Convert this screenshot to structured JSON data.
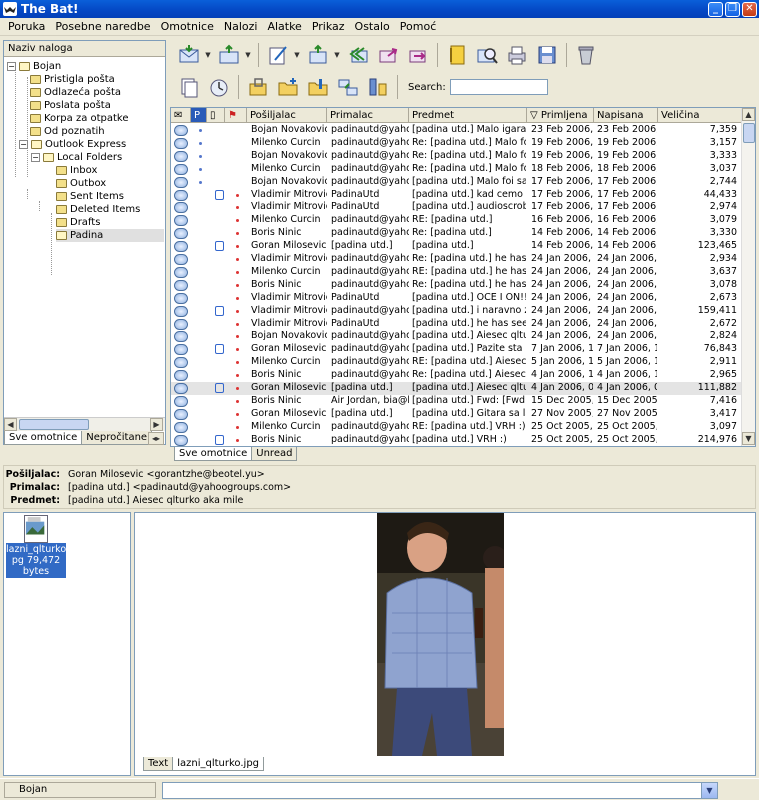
{
  "window": {
    "title": "The Bat!"
  },
  "menu": [
    "Poruka",
    "Posebne naredbe",
    "Omotnice",
    "Nalozi",
    "Alatke",
    "Prikaz",
    "Ostalo",
    "Pomoć"
  ],
  "folders": {
    "header": "Naziv naloga",
    "account": "Bojan",
    "items": [
      "Pristigla pošta",
      "Odlazeća pošta",
      "Poslata pošta",
      "Korpa za otpatke",
      "Od poznatih"
    ],
    "outlook": "Outlook Express",
    "local": "Local Folders",
    "local_items": [
      "Inbox",
      "Outbox",
      "Sent Items",
      "Deleted Items",
      "Drafts",
      "Padina"
    ],
    "tabs": [
      "Sve omotnice",
      "Nepročitane"
    ]
  },
  "toolbar": {
    "search_label": "Search:",
    "search_value": "",
    "icons_row1": [
      "get-mail-icon",
      "send-mail-icon",
      "new-message-icon",
      "reply-icon",
      "reply-all-icon",
      "forward-icon",
      "redirect-icon",
      "address-book-icon",
      "find-icon",
      "print-icon",
      "save-icon",
      "delete-icon"
    ],
    "icons_row2": [
      "copy-message-icon",
      "move-message-icon",
      "new-folder-icon",
      "folder-lock-icon",
      "folder-properties-icon",
      "filter-icon",
      "sort-icon"
    ]
  },
  "columns": [
    "Pošiljalac",
    "Primalac",
    "Predmet",
    "Primljena",
    "Napisana",
    "Veličina"
  ],
  "messages": [
    {
      "from": "Bojan Novakovic",
      "to": "padinautd@yahoo....",
      "subject": "[padina utd.] Malo igara sa [...",
      "received": "23 Feb 2006, ...",
      "written": "23 Feb 2006, ...",
      "size": "7,359",
      "dot": "#5577cc",
      "clip": false
    },
    {
      "from": "Milenko Curcin",
      "to": "padinautd@yahoo....",
      "subject": "Re: [padina utd.] Malo foi sa...",
      "received": "19 Feb 2006, ...",
      "written": "19 Feb 2006, ...",
      "size": "3,157",
      "dot": "#5577cc",
      "clip": false
    },
    {
      "from": "Bojan Novakovic",
      "to": "padinautd@yahoo....",
      "subject": "Re: [padina utd.] Malo foi sa...",
      "received": "19 Feb 2006, ...",
      "written": "19 Feb 2006, ...",
      "size": "3,333",
      "dot": "#5577cc",
      "clip": false
    },
    {
      "from": "Milenko Curcin",
      "to": "padinautd@yahoo....",
      "subject": "Re: [padina utd.] Malo foi sa...",
      "received": "18 Feb 2006, ...",
      "written": "18 Feb 2006, ...",
      "size": "3,037",
      "dot": "#5577cc",
      "clip": false
    },
    {
      "from": "Bojan Novakovic",
      "to": "padinautd@yahoo....",
      "subject": "[padina utd.] Malo foi sa ben...",
      "received": "17 Feb 2006, ...",
      "written": "17 Feb 2006, ...",
      "size": "2,744",
      "dot": "#5577cc",
      "clip": false
    },
    {
      "from": "Vladimir Mitrovic",
      "to": "PadinaUtd",
      "subject": "[padina utd.] kad cemo na tir...",
      "received": "17 Feb 2006, ...",
      "written": "17 Feb 2006, ...",
      "size": "44,433",
      "dot": "#dd3333",
      "clip": true
    },
    {
      "from": "Vladimir Mitrovic",
      "to": "PadinaUtd",
      "subject": "[padina utd.] audioscrobbler",
      "received": "17 Feb 2006, ...",
      "written": "17 Feb 2006, ...",
      "size": "2,974",
      "dot": "#dd3333",
      "clip": false
    },
    {
      "from": "Milenko Curcin",
      "to": "padinautd@yahoo....",
      "subject": "RE: [padina utd.]",
      "received": "16 Feb 2006, ...",
      "written": "16 Feb 2006, ...",
      "size": "3,079",
      "dot": "#dd3333",
      "clip": false
    },
    {
      "from": "Boris Ninic",
      "to": "padinautd@yahoo....",
      "subject": "Re: [padina utd.]",
      "received": "14 Feb 2006, ...",
      "written": "14 Feb 2006, ...",
      "size": "3,330",
      "dot": "#dd3333",
      "clip": false
    },
    {
      "from": "Goran Milosevic",
      "to": "[padina utd.]",
      "subject": "[padina utd.]",
      "received": "14 Feb 2006, ...",
      "written": "14 Feb 2006, ...",
      "size": "123,465",
      "dot": "#dd3333",
      "clip": true
    },
    {
      "from": "Vladimir Mitrovic",
      "to": "padinautd@yahoo....",
      "subject": "Re: [padina utd.] he has see...",
      "received": "24 Jan 2006, ...",
      "written": "24 Jan 2006, ...",
      "size": "2,934",
      "dot": "#dd3333",
      "clip": false
    },
    {
      "from": "Milenko Curcin",
      "to": "padinautd@yahoo....",
      "subject": "RE: [padina utd.] he has see...",
      "received": "24 Jan 2006, ...",
      "written": "24 Jan 2006, ...",
      "size": "3,637",
      "dot": "#dd3333",
      "clip": false
    },
    {
      "from": "Boris Ninic",
      "to": "padinautd@yahoo....",
      "subject": "Re: [padina utd.] he has see...",
      "received": "24 Jan 2006, ...",
      "written": "24 Jan 2006, ...",
      "size": "3,078",
      "dot": "#dd3333",
      "clip": false
    },
    {
      "from": "Vladimir Mitrovic",
      "to": "PadinaUtd",
      "subject": "[padina utd.] OCE I ON!!!! O...",
      "received": "24 Jan 2006, ...",
      "written": "24 Jan 2006, ...",
      "size": "2,673",
      "dot": "#dd3333",
      "clip": false
    },
    {
      "from": "Vladimir Mitrovic",
      "to": "padinautd@yahoo....",
      "subject": "[padina utd.] i naravno zabor...",
      "received": "24 Jan 2006, ...",
      "written": "24 Jan 2006, ...",
      "size": "159,411",
      "dot": "#dd3333",
      "clip": true
    },
    {
      "from": "Vladimir Mitrovic",
      "to": "PadinaUtd",
      "subject": "[padina utd.] he has seen th...",
      "received": "24 Jan 2006, ...",
      "written": "24 Jan 2006, ...",
      "size": "2,672",
      "dot": "#dd3333",
      "clip": false
    },
    {
      "from": "Bojan Novakovic",
      "to": "padinautd@yahoo....",
      "subject": "[padina utd.] Aiesec qlturko...",
      "received": "24 Jan 2006, ...",
      "written": "24 Jan 2006, ...",
      "size": "2,824",
      "dot": "#dd3333",
      "clip": false
    },
    {
      "from": "Goran Milosevic",
      "to": "padinautd@yahoo....",
      "subject": "[padina utd.] Pazite sta sami i...",
      "received": "7 Jan 2006, 1...",
      "written": "7 Jan 2006, 1...",
      "size": "76,843",
      "dot": "#dd3333",
      "clip": true
    },
    {
      "from": "Milenko Curcin",
      "to": "padinautd@yahoo....",
      "subject": "RE: [padina utd.] Aiesec qltur...",
      "received": "5 Jan 2006, 1...",
      "written": "5 Jan 2006, 1...",
      "size": "2,911",
      "dot": "#dd3333",
      "clip": false
    },
    {
      "from": "Boris Ninic",
      "to": "padinautd@yahoo....",
      "subject": "Re: [padina utd.] Aiesec qltur...",
      "received": "4 Jan 2006, 1...",
      "written": "4 Jan 2006, 1...",
      "size": "2,965",
      "dot": "#dd3333",
      "clip": false
    },
    {
      "from": "Goran Milosevic",
      "to": "[padina utd.]",
      "subject": "[padina utd.] Aiesec qlturko ...",
      "received": "4 Jan 2006, 0...",
      "written": "4 Jan 2006, 0...",
      "size": "111,882",
      "dot": "#dd3333",
      "clip": true
    },
    {
      "from": "Boris Ninic",
      "to": "Air Jordan, bia@bi...",
      "subject": "[padina utd.] Fwd: [Fwd: Fw:...",
      "received": "15 Dec 2005, ...",
      "written": "15 Dec 2005, ...",
      "size": "7,416",
      "dot": "#dd3333",
      "clip": false
    },
    {
      "from": "Goran Milosevic",
      "to": "[padina utd.]",
      "subject": "[padina utd.] Gitara sa laseri...",
      "received": "27 Nov 2005, ...",
      "written": "27 Nov 2005, ...",
      "size": "3,417",
      "dot": "#dd3333",
      "clip": false
    },
    {
      "from": "Milenko Curcin",
      "to": "padinautd@yahoo....",
      "subject": "RE: [padina utd.] VRH :)",
      "received": "25 Oct 2005, ...",
      "written": "25 Oct 2005, ...",
      "size": "3,097",
      "dot": "#dd3333",
      "clip": false
    },
    {
      "from": "Boris Ninic",
      "to": "padinautd@yahoo....",
      "subject": "[padina utd.] VRH :)",
      "received": "25 Oct 2005, ...",
      "written": "25 Oct 2005, ...",
      "size": "214,976",
      "dot": "#dd3333",
      "clip": true
    }
  ],
  "list_tabs": [
    "Sve omotnice",
    "Unread"
  ],
  "header": {
    "from_label": "Pošiljalac:",
    "from": "Goran Milosevic <gorantzhe@beotel.yu>",
    "to_label": "Primalac:",
    "to": "[padina utd.] <padinautd@yahoogroups.com>",
    "subject_label": "Predmet:",
    "subject": "[padina utd.] Aiesec qlturko aka mile"
  },
  "attachment": {
    "name_line1": "lazni_qlturko.j",
    "name_line2": "pg 79,472",
    "name_line3": "bytes"
  },
  "viewer_tabs": [
    "Text",
    "lazni_qlturko.jpg"
  ],
  "status": {
    "account": "Bojan"
  }
}
